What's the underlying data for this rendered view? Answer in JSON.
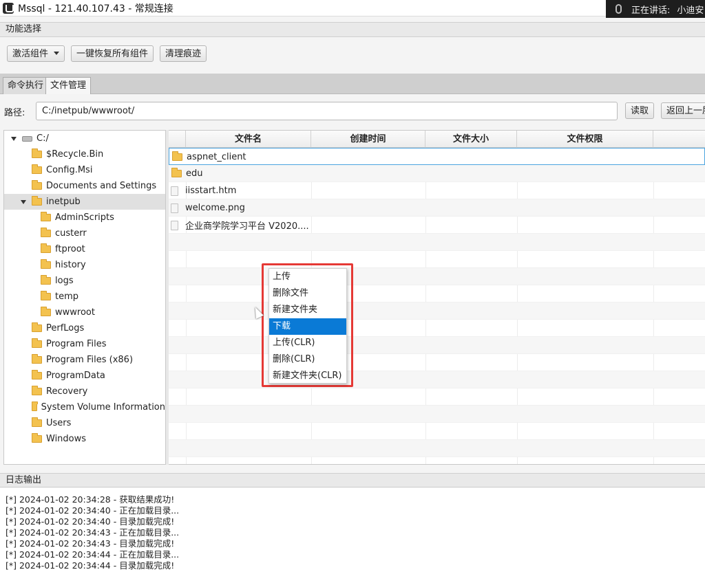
{
  "window": {
    "title": "Mssql - 121.40.107.43 - 常规连接",
    "speaking_label": "正在讲话:",
    "speaker": "小迪安"
  },
  "func_section": {
    "title": "功能选择"
  },
  "toolbar": {
    "activate": "激活组件",
    "restore_all": "一键恢复所有组件",
    "clear_traces": "清理痕迹"
  },
  "tabs": [
    {
      "label": "命令执行",
      "active": false
    },
    {
      "label": "文件管理",
      "active": true
    }
  ],
  "path": {
    "label": "路径:",
    "value": "C:/inetpub/wwwroot/",
    "read_button": "读取",
    "up_button": "返回上一层"
  },
  "tree": {
    "root": "C:/",
    "items": [
      "$Recycle.Bin",
      "Config.Msi",
      "Documents and Settings",
      "inetpub",
      "AdminScripts",
      "custerr",
      "ftproot",
      "history",
      "logs",
      "temp",
      "wwwroot",
      "PerfLogs",
      "Program Files",
      "Program Files (x86)",
      "ProgramData",
      "Recovery",
      "System Volume Information",
      "Users",
      "Windows"
    ]
  },
  "table": {
    "columns": [
      "文件名",
      "创建时间",
      "文件大小",
      "文件权限"
    ],
    "rows": [
      {
        "name": "aspnet_client",
        "type": "folder"
      },
      {
        "name": "edu",
        "type": "folder"
      },
      {
        "name": "iisstart.htm",
        "type": "file"
      },
      {
        "name": "welcome.png",
        "type": "file"
      },
      {
        "name": "企业商学院学习平台 V2020....",
        "type": "file"
      }
    ]
  },
  "context_menu": {
    "items": [
      "上传",
      "删除文件",
      "新建文件夹",
      "下载",
      "上传(CLR)",
      "删除(CLR)",
      "新建文件夹(CLR)"
    ],
    "active": "下载"
  },
  "log": {
    "title": "日志输出",
    "lines": [
      "[*] 2024-01-02 20:34:28 - 获取结果成功!",
      "[*] 2024-01-02 20:34:40 - 正在加载目录...",
      "[*] 2024-01-02 20:34:40 - 目录加载完成!",
      "[*] 2024-01-02 20:34:43 - 正在加载目录...",
      "[*] 2024-01-02 20:34:43 - 目录加载完成!",
      "[*] 2024-01-02 20:34:44 - 正在加载目录...",
      "[*] 2024-01-02 20:34:44 - 目录加载完成!"
    ]
  },
  "colors": {
    "menu_active": "#0a7ad6",
    "highlight_box": "#e53935",
    "folder": "#f3c24f"
  }
}
